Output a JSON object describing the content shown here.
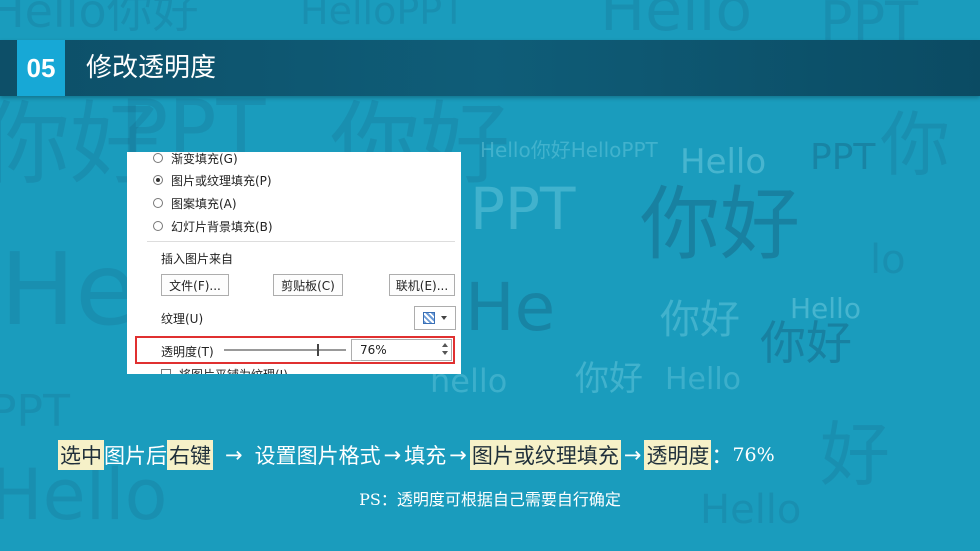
{
  "header": {
    "number": "05",
    "title": "修改透明度"
  },
  "dialog": {
    "fill_options": [
      {
        "label": "渐变填充(G)",
        "checked": false
      },
      {
        "label": "图片或纹理填充(P)",
        "checked": true
      },
      {
        "label": "图案填充(A)",
        "checked": false
      },
      {
        "label": "幻灯片背景填充(B)",
        "checked": false
      }
    ],
    "insert_from_label": "插入图片来自",
    "buttons": {
      "file": "文件(F)...",
      "clipboard": "剪贴板(C)",
      "online": "联机(E)..."
    },
    "texture_label": "纹理(U)",
    "transparency": {
      "label": "透明度(T)",
      "value": "76%",
      "percent": 76
    },
    "tile_label": "将图片平铺为纹理(I)"
  },
  "instruction": {
    "part1": "选中",
    "part2": "图片后",
    "part3": "右键",
    "arrow": "→",
    "part4": "设置图片格式",
    "part5": "填充",
    "part6": "图片或纹理填充",
    "part7": "透明度",
    "colon": "：",
    "value": "76%"
  },
  "ps_note": "PS：透明度可根据自己需要自行确定",
  "colors": {
    "background": "#1a9cbd",
    "header": "#0f5d78",
    "badge": "#17a8d6",
    "highlight": "#f6f1c8",
    "red_box": "#e03030"
  }
}
